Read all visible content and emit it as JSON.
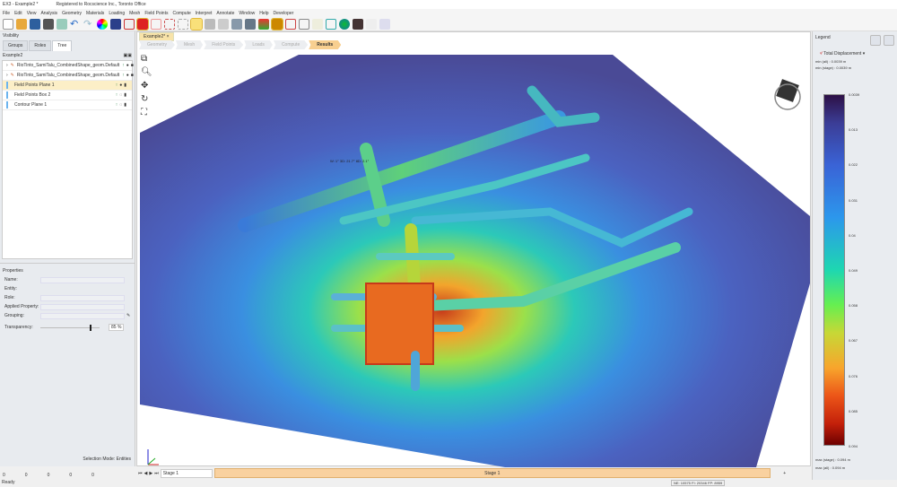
{
  "title": {
    "app": "EX3 - Example2 *",
    "registered": "Registered to Rocscience Inc., Toronto Office"
  },
  "menu": [
    "File",
    "Edit",
    "View",
    "Analysis",
    "Geometry",
    "Materials",
    "Loading",
    "Mesh",
    "Field Points",
    "Compute",
    "Interpret",
    "Annotate",
    "Window",
    "Help",
    "Developer"
  ],
  "visibility": {
    "title": "Visibility",
    "tabs": [
      "Groups",
      "Roles",
      "Tree"
    ],
    "root": "Example2",
    "items": [
      {
        "label": "RioTinto_SamiTalu_CombinedShape_geom.Default"
      },
      {
        "label": "RioTinto_SamiTalu_CombinedShape_geom.Default"
      },
      {
        "label": "Field Points Plane 1"
      },
      {
        "label": "Field Points Box 2"
      },
      {
        "label": "Contour Plane 1"
      }
    ]
  },
  "properties": {
    "title": "Properties",
    "name": "Name:",
    "entity": "Entity:",
    "role": "Role:",
    "applied": "Applied Property:",
    "grouping": "Grouping:",
    "transparency": "Transparency:",
    "transparency_value": "85 %",
    "transparency_fraction": 0.85,
    "selection_mode": "Selection Mode: Entities",
    "counts": [
      "0",
      "0",
      "0",
      "0",
      "0"
    ]
  },
  "document_tab": "Example2*",
  "workflow": [
    "Geometry",
    "Mesh",
    "Field Points",
    "Loads",
    "Compute",
    "Results"
  ],
  "active_workflow": "Results",
  "annotation": "W: 1° 3D: 21.7° 8D: 2.1°",
  "legend": {
    "title": "Legend",
    "quantity": "Total Displacement",
    "min_all": "min (all) :",
    "min_all_v": "0.0039 m",
    "min_stage": "min (stage) :",
    "min_stage_v": "0.0039 m",
    "ticks": [
      "0.0039",
      "0.013",
      "0.022",
      "0.031",
      "0.04",
      "0.049",
      "0.058",
      "0.067",
      "0.076",
      "0.085",
      "0.094"
    ],
    "max_stage": "max (stage) :",
    "max_stage_v": "0.094 m",
    "max_all": "max (all) :",
    "max_all_v": "0.094 m"
  },
  "stage": {
    "selected": "Stage 1",
    "bar": "Stage 1",
    "add": "+"
  },
  "status": {
    "ready": "Ready",
    "counts": "NE: 10575 FI: 20346 FP: 8959"
  }
}
